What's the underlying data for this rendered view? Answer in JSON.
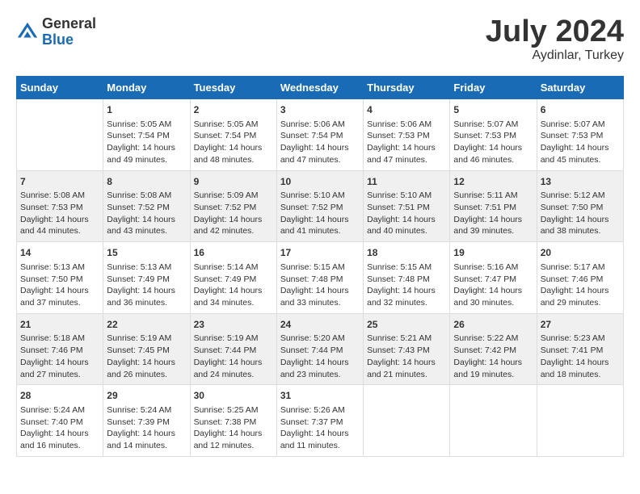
{
  "header": {
    "logo_general": "General",
    "logo_blue": "Blue",
    "title": "July 2024",
    "location": "Aydinlar, Turkey"
  },
  "days_of_week": [
    "Sunday",
    "Monday",
    "Tuesday",
    "Wednesday",
    "Thursday",
    "Friday",
    "Saturday"
  ],
  "weeks": [
    [
      {
        "day": "",
        "sunrise": "",
        "sunset": "",
        "daylight": ""
      },
      {
        "day": "1",
        "sunrise": "Sunrise: 5:05 AM",
        "sunset": "Sunset: 7:54 PM",
        "daylight": "Daylight: 14 hours and 49 minutes."
      },
      {
        "day": "2",
        "sunrise": "Sunrise: 5:05 AM",
        "sunset": "Sunset: 7:54 PM",
        "daylight": "Daylight: 14 hours and 48 minutes."
      },
      {
        "day": "3",
        "sunrise": "Sunrise: 5:06 AM",
        "sunset": "Sunset: 7:54 PM",
        "daylight": "Daylight: 14 hours and 47 minutes."
      },
      {
        "day": "4",
        "sunrise": "Sunrise: 5:06 AM",
        "sunset": "Sunset: 7:53 PM",
        "daylight": "Daylight: 14 hours and 47 minutes."
      },
      {
        "day": "5",
        "sunrise": "Sunrise: 5:07 AM",
        "sunset": "Sunset: 7:53 PM",
        "daylight": "Daylight: 14 hours and 46 minutes."
      },
      {
        "day": "6",
        "sunrise": "Sunrise: 5:07 AM",
        "sunset": "Sunset: 7:53 PM",
        "daylight": "Daylight: 14 hours and 45 minutes."
      }
    ],
    [
      {
        "day": "7",
        "sunrise": "Sunrise: 5:08 AM",
        "sunset": "Sunset: 7:53 PM",
        "daylight": "Daylight: 14 hours and 44 minutes."
      },
      {
        "day": "8",
        "sunrise": "Sunrise: 5:08 AM",
        "sunset": "Sunset: 7:52 PM",
        "daylight": "Daylight: 14 hours and 43 minutes."
      },
      {
        "day": "9",
        "sunrise": "Sunrise: 5:09 AM",
        "sunset": "Sunset: 7:52 PM",
        "daylight": "Daylight: 14 hours and 42 minutes."
      },
      {
        "day": "10",
        "sunrise": "Sunrise: 5:10 AM",
        "sunset": "Sunset: 7:52 PM",
        "daylight": "Daylight: 14 hours and 41 minutes."
      },
      {
        "day": "11",
        "sunrise": "Sunrise: 5:10 AM",
        "sunset": "Sunset: 7:51 PM",
        "daylight": "Daylight: 14 hours and 40 minutes."
      },
      {
        "day": "12",
        "sunrise": "Sunrise: 5:11 AM",
        "sunset": "Sunset: 7:51 PM",
        "daylight": "Daylight: 14 hours and 39 minutes."
      },
      {
        "day": "13",
        "sunrise": "Sunrise: 5:12 AM",
        "sunset": "Sunset: 7:50 PM",
        "daylight": "Daylight: 14 hours and 38 minutes."
      }
    ],
    [
      {
        "day": "14",
        "sunrise": "Sunrise: 5:13 AM",
        "sunset": "Sunset: 7:50 PM",
        "daylight": "Daylight: 14 hours and 37 minutes."
      },
      {
        "day": "15",
        "sunrise": "Sunrise: 5:13 AM",
        "sunset": "Sunset: 7:49 PM",
        "daylight": "Daylight: 14 hours and 36 minutes."
      },
      {
        "day": "16",
        "sunrise": "Sunrise: 5:14 AM",
        "sunset": "Sunset: 7:49 PM",
        "daylight": "Daylight: 14 hours and 34 minutes."
      },
      {
        "day": "17",
        "sunrise": "Sunrise: 5:15 AM",
        "sunset": "Sunset: 7:48 PM",
        "daylight": "Daylight: 14 hours and 33 minutes."
      },
      {
        "day": "18",
        "sunrise": "Sunrise: 5:15 AM",
        "sunset": "Sunset: 7:48 PM",
        "daylight": "Daylight: 14 hours and 32 minutes."
      },
      {
        "day": "19",
        "sunrise": "Sunrise: 5:16 AM",
        "sunset": "Sunset: 7:47 PM",
        "daylight": "Daylight: 14 hours and 30 minutes."
      },
      {
        "day": "20",
        "sunrise": "Sunrise: 5:17 AM",
        "sunset": "Sunset: 7:46 PM",
        "daylight": "Daylight: 14 hours and 29 minutes."
      }
    ],
    [
      {
        "day": "21",
        "sunrise": "Sunrise: 5:18 AM",
        "sunset": "Sunset: 7:46 PM",
        "daylight": "Daylight: 14 hours and 27 minutes."
      },
      {
        "day": "22",
        "sunrise": "Sunrise: 5:19 AM",
        "sunset": "Sunset: 7:45 PM",
        "daylight": "Daylight: 14 hours and 26 minutes."
      },
      {
        "day": "23",
        "sunrise": "Sunrise: 5:19 AM",
        "sunset": "Sunset: 7:44 PM",
        "daylight": "Daylight: 14 hours and 24 minutes."
      },
      {
        "day": "24",
        "sunrise": "Sunrise: 5:20 AM",
        "sunset": "Sunset: 7:44 PM",
        "daylight": "Daylight: 14 hours and 23 minutes."
      },
      {
        "day": "25",
        "sunrise": "Sunrise: 5:21 AM",
        "sunset": "Sunset: 7:43 PM",
        "daylight": "Daylight: 14 hours and 21 minutes."
      },
      {
        "day": "26",
        "sunrise": "Sunrise: 5:22 AM",
        "sunset": "Sunset: 7:42 PM",
        "daylight": "Daylight: 14 hours and 19 minutes."
      },
      {
        "day": "27",
        "sunrise": "Sunrise: 5:23 AM",
        "sunset": "Sunset: 7:41 PM",
        "daylight": "Daylight: 14 hours and 18 minutes."
      }
    ],
    [
      {
        "day": "28",
        "sunrise": "Sunrise: 5:24 AM",
        "sunset": "Sunset: 7:40 PM",
        "daylight": "Daylight: 14 hours and 16 minutes."
      },
      {
        "day": "29",
        "sunrise": "Sunrise: 5:24 AM",
        "sunset": "Sunset: 7:39 PM",
        "daylight": "Daylight: 14 hours and 14 minutes."
      },
      {
        "day": "30",
        "sunrise": "Sunrise: 5:25 AM",
        "sunset": "Sunset: 7:38 PM",
        "daylight": "Daylight: 14 hours and 12 minutes."
      },
      {
        "day": "31",
        "sunrise": "Sunrise: 5:26 AM",
        "sunset": "Sunset: 7:37 PM",
        "daylight": "Daylight: 14 hours and 11 minutes."
      },
      {
        "day": "",
        "sunrise": "",
        "sunset": "",
        "daylight": ""
      },
      {
        "day": "",
        "sunrise": "",
        "sunset": "",
        "daylight": ""
      },
      {
        "day": "",
        "sunrise": "",
        "sunset": "",
        "daylight": ""
      }
    ]
  ]
}
